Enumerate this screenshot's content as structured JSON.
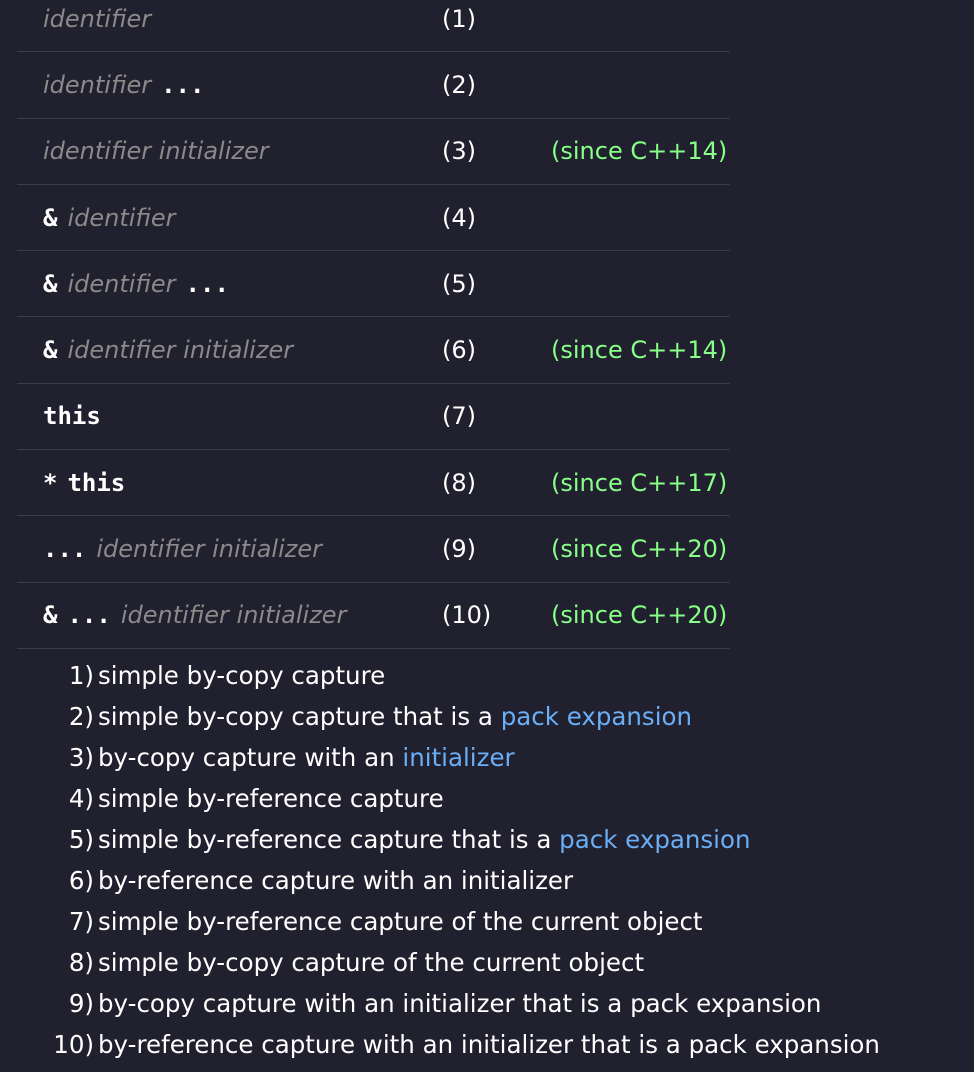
{
  "rows": [
    {
      "num": "(1)",
      "since": "",
      "parts": [
        {
          "k": "param",
          "text": "identifier"
        }
      ]
    },
    {
      "num": "(2)",
      "since": "",
      "parts": [
        {
          "k": "param",
          "text": "identifier"
        },
        {
          "k": "tok",
          "text": "..."
        }
      ]
    },
    {
      "num": "(3)",
      "since": "(since C++14)",
      "parts": [
        {
          "k": "param",
          "text": "identifier initializer"
        }
      ]
    },
    {
      "num": "(4)",
      "since": "",
      "parts": [
        {
          "k": "tok",
          "text": "&"
        },
        {
          "k": "param",
          "text": "identifier"
        }
      ]
    },
    {
      "num": "(5)",
      "since": "",
      "parts": [
        {
          "k": "tok",
          "text": "&"
        },
        {
          "k": "param",
          "text": "identifier"
        },
        {
          "k": "tok",
          "text": "..."
        }
      ]
    },
    {
      "num": "(6)",
      "since": "(since C++14)",
      "parts": [
        {
          "k": "tok",
          "text": "&"
        },
        {
          "k": "param",
          "text": "identifier initializer"
        }
      ]
    },
    {
      "num": "(7)",
      "since": "",
      "parts": [
        {
          "k": "kw",
          "text": "this"
        }
      ]
    },
    {
      "num": "(8)",
      "since": "(since C++17)",
      "parts": [
        {
          "k": "tok",
          "text": "*"
        },
        {
          "k": "kw",
          "text": "this"
        }
      ]
    },
    {
      "num": "(9)",
      "since": "(since C++20)",
      "parts": [
        {
          "k": "tok",
          "text": "..."
        },
        {
          "k": "param",
          "text": "identifier initializer"
        }
      ]
    },
    {
      "num": "(10)",
      "since": "(since C++20)",
      "parts": [
        {
          "k": "tok",
          "text": "&"
        },
        {
          "k": "tok",
          "text": "..."
        },
        {
          "k": "param",
          "text": "identifier initializer"
        }
      ]
    }
  ],
  "notes": [
    {
      "num": "1)",
      "text": "simple by-copy capture",
      "link": ""
    },
    {
      "num": "2)",
      "text": "simple by-copy capture that is a ",
      "link": "pack expansion"
    },
    {
      "num": "3)",
      "text": "by-copy capture with an ",
      "link": "initializer"
    },
    {
      "num": "4)",
      "text": "simple by-reference capture",
      "link": ""
    },
    {
      "num": "5)",
      "text": "simple by-reference capture that is a ",
      "link": "pack expansion"
    },
    {
      "num": "6)",
      "text": "by-reference capture with an initializer",
      "link": ""
    },
    {
      "num": "7)",
      "text": "simple by-reference capture of the current object",
      "link": ""
    },
    {
      "num": "8)",
      "text": "simple by-copy capture of the current object",
      "link": ""
    },
    {
      "num": "9)",
      "text": "by-copy capture with an initializer that is a pack expansion",
      "link": ""
    },
    {
      "num": "10)",
      "text": "by-reference capture with an initializer that is a pack expansion",
      "link": ""
    }
  ],
  "colors": {
    "background": "#20202e",
    "since": "#88ff88",
    "link": "#6aaef5",
    "param": "#8a8a8a"
  }
}
